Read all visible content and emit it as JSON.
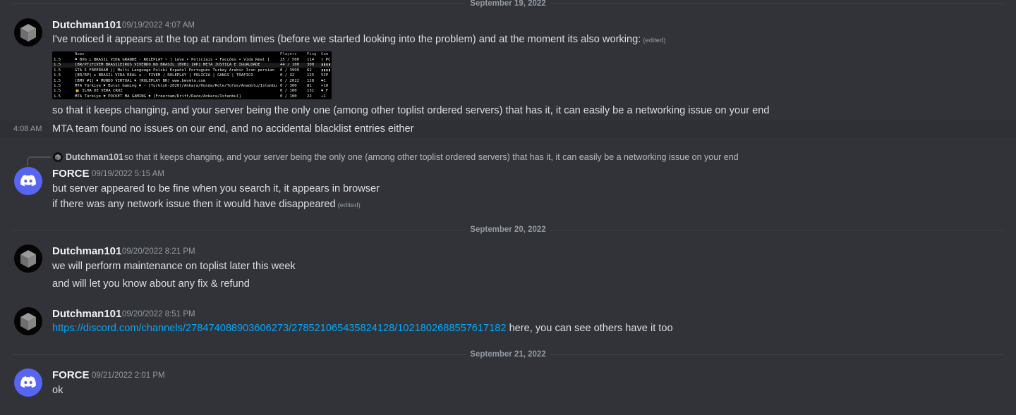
{
  "dividers": {
    "d1": "September 19, 2022",
    "d2": "September 20, 2022",
    "d3": "September 21, 2022"
  },
  "messages": {
    "m1": {
      "author": "Dutchman101",
      "time": "09/19/2022 4:07 AM",
      "line1": "I've noticed it appears at the top at random times (before we started looking into the problem) and at the moment its also working:",
      "edited": "(edited)",
      "line2": "so that it keeps changing, and your server being the only one (among other toplist ordered servers) that has it, it can easily be a networking issue on your end"
    },
    "m2": {
      "side_time": "4:08 AM",
      "text": "MTA team found no issues on our end, and no accidental blacklist entries either"
    },
    "m3": {
      "reply_author": "Dutchman101",
      "reply_text": "so that it keeps changing, and your server being the only one (among other toplist ordered servers) that has it, it can easily be a networking issue on your end",
      "author": "FORCE",
      "time": "09/19/2022 5:15 AM",
      "line1": "but server appeared to be fine when you search it, it appears in browser",
      "line2": "if there was any network issue then it would have disappeared",
      "edited": "(edited)"
    },
    "m4": {
      "author": "Dutchman101",
      "time": "09/20/2022 8:21 PM",
      "line1": "we will perform maintenance on toplist later this week",
      "line2": "and will let you know about any fix & refund"
    },
    "m5": {
      "author": "Dutchman101",
      "time": "09/20/2022 8:51 PM",
      "link": "https://discord.com/channels/278474088903606273/278521065435824128/1021802688557617182",
      "text": " here, you can see others have it too"
    },
    "m6": {
      "author": "FORCE",
      "time": "09/21/2022 2:01 PM",
      "text": "ok"
    }
  },
  "embed": {
    "headers": [
      "Name",
      "Players",
      "Ping",
      "Gam"
    ],
    "rows": [
      [
        "1.5",
        "⚑ BVG ⟂ BRASIL VIDA GRANDE - ROLEPLAY ~ [ Leve • Policiais • Facções • Vida Real ]",
        "25 / 500",
        "114",
        "[ PC"
      ],
      [
        "1.5",
        "[BR/PT]FIVEM BRASILEIROS VIVENDO NO BRASIL [BVB] [RP] META JUSTIÇA E IGUALDADE",
        "44 / 100",
        "300",
        "▮▮▮▮"
      ],
      [
        "1.5",
        "GTA 5 FREEROAM || Multi Language Polski Español Português Turkey Arabic Iran persian brazil",
        "0 / 3999",
        "62",
        "▮▮▮▮"
      ],
      [
        "1.5",
        "[BR/RP] ✚ BRASIL VIDA REAL ✚ - FIVEM | ROLEPLAY | POLICIA | GANGS | TRAFICO",
        "0 / 32",
        "125",
        "VIP"
      ],
      [
        "1.5",
        "[BMV #1] ✖ MUNDO VIRTUAL ✖ [ROLEPLAY BR] www.bmvmta.com",
        "0 / 2022",
        "128",
        "❤C"
      ],
      [
        "1.5",
        "MTA Türkiye ✖ Bulut Gaming ✖ - [Turkish-2020]/Ankara/Honda/Role/Tofas/Anadolu/Istanbul",
        "0 / 300",
        "81",
        "+10"
      ],
      [
        "1.5",
        "🔒 ILHA DE VERA CRUZ",
        "0 / 100",
        "131",
        "❤ F"
      ],
      [
        "1.5",
        "MTA Türkiye ✖ POCKET MA GAMING ✖ [Freeroam/Drift/Race/Ankara/Istanbul]",
        "0 / 100",
        "22",
        "+1"
      ]
    ]
  },
  "colors": {
    "background": "#313338",
    "username": "#f2f3f5",
    "link": "#00a8fc",
    "discord_blurple": "#5865f2"
  }
}
